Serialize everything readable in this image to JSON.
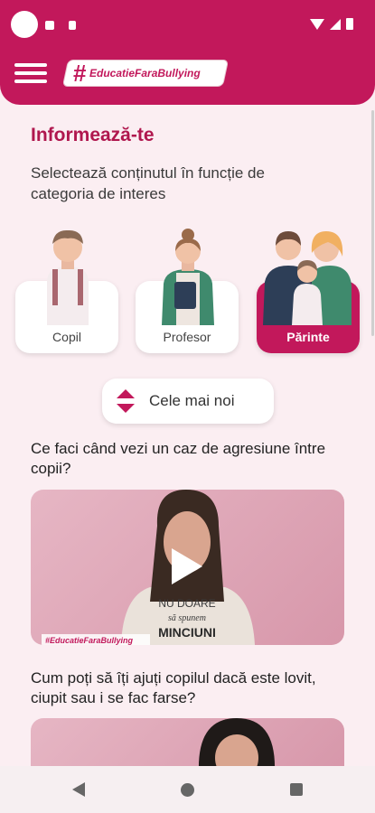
{
  "header": {
    "logo_hash": "#",
    "logo_text": "EducatieFaraBullying"
  },
  "page": {
    "title": "Informează-te",
    "subtitle": "Selectează conținutul în funcție de categoria de interes"
  },
  "categories": [
    {
      "label": "Copil",
      "active": false
    },
    {
      "label": "Profesor",
      "active": false
    },
    {
      "label": "Părinte",
      "active": true
    }
  ],
  "sort": {
    "label": "Cele mai noi"
  },
  "videos": [
    {
      "question": "Ce faci când vezi un caz de agresiune între copii?",
      "shirt_line1": "NU DOARE",
      "shirt_line2": "să spunem",
      "shirt_line3": "MINCIUNI",
      "watermark": "#EducatieFaraBullying"
    },
    {
      "question": "Cum poți să îți ajuți copilul dacă este lovit, ciupit sau i se fac farse?"
    }
  ],
  "colors": {
    "accent": "#c2185b",
    "background": "#fbeef2"
  }
}
